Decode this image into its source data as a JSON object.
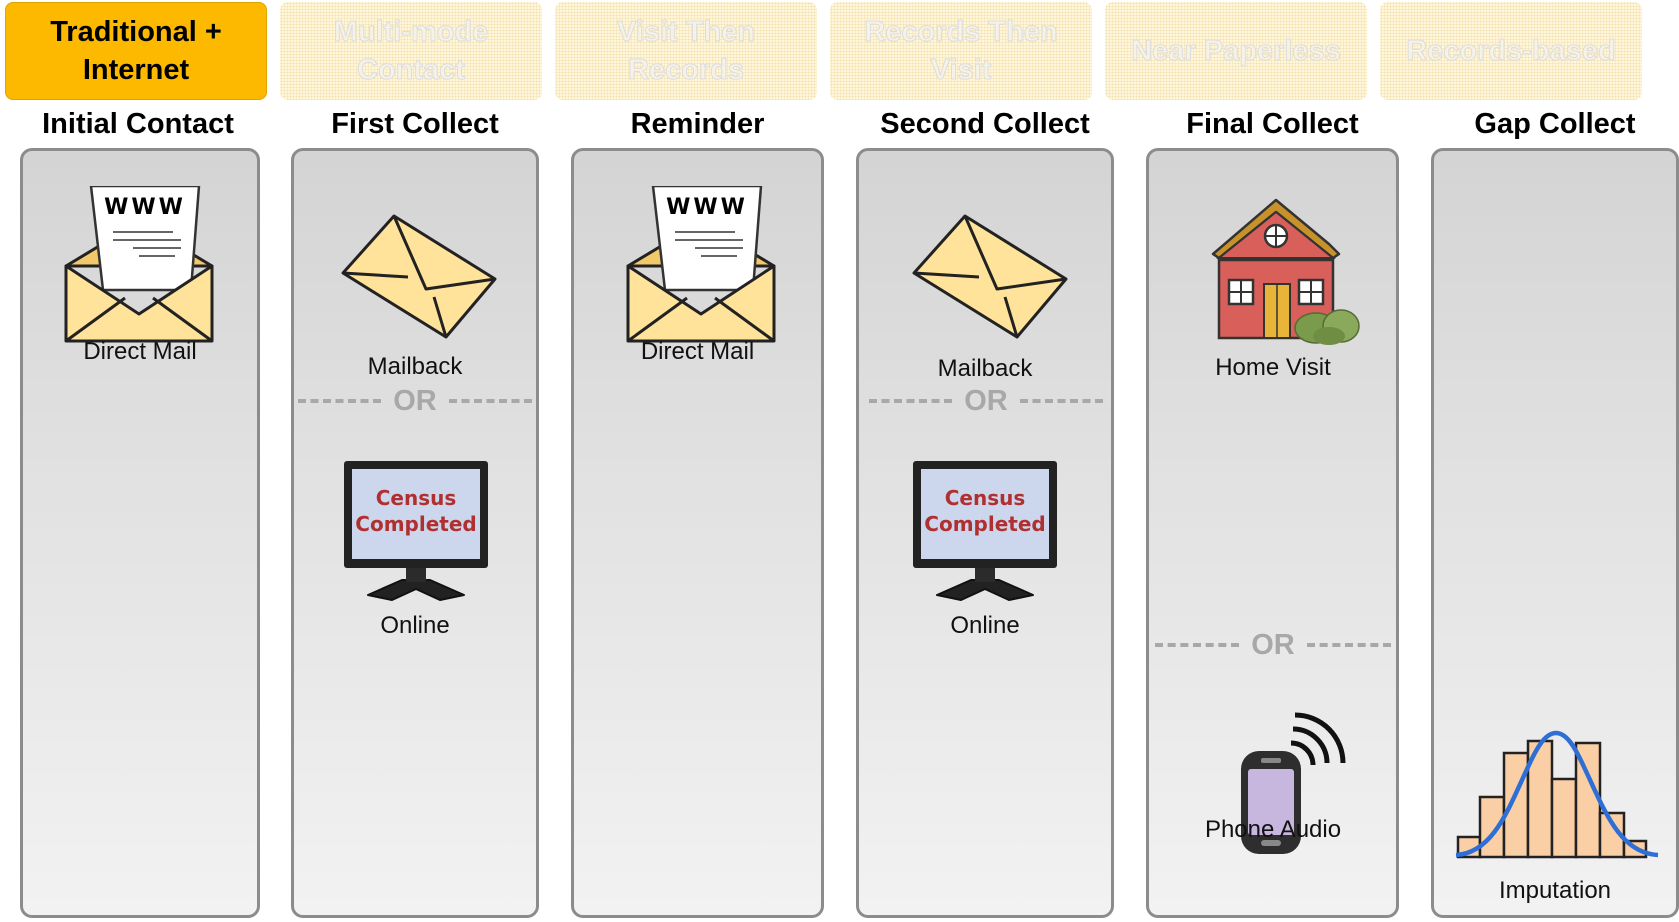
{
  "tabs": [
    {
      "label": "Traditional +\nInternet",
      "active": true
    },
    {
      "label": "Multi-mode\nContact",
      "active": false
    },
    {
      "label": "Visit Then\nRecords",
      "active": false
    },
    {
      "label": "Records Then\nVisit",
      "active": false
    },
    {
      "label": "Near Paperless",
      "active": false
    },
    {
      "label": "Records-based",
      "active": false
    }
  ],
  "columns": [
    {
      "title": "Initial Contact",
      "items": [
        "Direct Mail"
      ]
    },
    {
      "title": "First Collect",
      "items": [
        "Mailback",
        "Online"
      ]
    },
    {
      "title": "Reminder",
      "items": [
        "Direct Mail"
      ]
    },
    {
      "title": "Second Collect",
      "items": [
        "Mailback",
        "Online"
      ]
    },
    {
      "title": "Final Collect",
      "items": [
        "Home Visit",
        "Phone Audio"
      ]
    },
    {
      "title": "Gap Collect",
      "items": [
        "Imputation"
      ]
    }
  ],
  "separator_text": "OR",
  "letter_text": "WWW",
  "screen_text": {
    "line1": "Census",
    "line2": "Completed"
  },
  "colors": {
    "active_tab": "#fcb900",
    "inactive_tab": "#fff6dc",
    "envelope": "#ffe39a",
    "census_text": "#b03030",
    "house_wall": "#d9605a",
    "histogram_bar": "#fbcfa6",
    "bell_curve": "#2e6fd6"
  },
  "icons": {
    "direct_mail": "envelope-with-letter-icon",
    "mailback": "envelope-icon",
    "online": "computer-monitor-icon",
    "home_visit": "house-icon",
    "phone_audio": "mobile-phone-icon",
    "imputation": "histogram-icon"
  }
}
